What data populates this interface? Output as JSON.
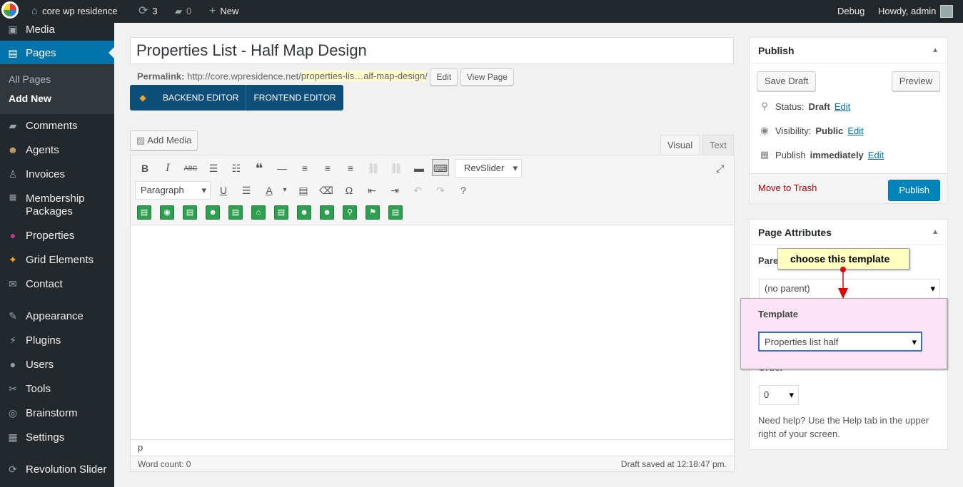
{
  "adminbar": {
    "site_name": "core wp residence",
    "updates_count": "3",
    "comments_count": "0",
    "new_label": "New",
    "debug_label": "Debug",
    "howdy": "Howdy, admin"
  },
  "sidebar": {
    "items": [
      {
        "label": "Media"
      },
      {
        "label": "Pages"
      },
      {
        "label": "Comments"
      },
      {
        "label": "Agents"
      },
      {
        "label": "Invoices"
      },
      {
        "label": "Membership Packages"
      },
      {
        "label": "Properties"
      },
      {
        "label": "Grid Elements"
      },
      {
        "label": "Contact"
      },
      {
        "label": "Appearance"
      },
      {
        "label": "Plugins"
      },
      {
        "label": "Users"
      },
      {
        "label": "Tools"
      },
      {
        "label": "Brainstorm"
      },
      {
        "label": "Settings"
      },
      {
        "label": "Revolution Slider"
      }
    ],
    "submenu": [
      "All Pages",
      "Add New"
    ]
  },
  "post": {
    "title": "Properties List - Half Map Design",
    "permalink_label": "Permalink:",
    "permalink_base": "http://core.wpresidence.net/",
    "permalink_slug": "properties-lis…alf-map-design",
    "permalink_trailing": "/",
    "edit_btn": "Edit",
    "view_btn": "View Page"
  },
  "vc": {
    "backend": "BACKEND EDITOR",
    "frontend": "FRONTEND EDITOR"
  },
  "editor": {
    "add_media": "Add Media",
    "tab_visual": "Visual",
    "tab_text": "Text",
    "revslider": "RevSlider",
    "format": "Paragraph",
    "path": "p",
    "word_count": "Word count: 0",
    "draft_saved": "Draft saved at 12:18:47 pm."
  },
  "publish": {
    "title": "Publish",
    "save_draft": "Save Draft",
    "preview": "Preview",
    "status_label": "Status:",
    "status_value": "Draft",
    "visibility_label": "Visibility:",
    "visibility_value": "Public",
    "publish_label": "Publish",
    "publish_value": "immediately",
    "edit": "Edit",
    "trash": "Move to Trash",
    "publish_btn": "Publish"
  },
  "attributes": {
    "title": "Page Attributes",
    "parent_label": "Pare",
    "parent_value": "(no parent)",
    "template_label": "Template",
    "template_value": "Properties list half",
    "order_label": "Order",
    "order_value": "0",
    "help": "Need help? Use the Help tab in the upper right of your screen."
  },
  "annotation": {
    "tooltip": "choose this template",
    "highlight_color": "#fce4f6",
    "arrow_color": "#e00000"
  },
  "colors": {
    "accent": "#0073aa",
    "publish_button": "#0085ba",
    "sidebar": "#23282d",
    "vc_bar": "#0f4e78"
  }
}
